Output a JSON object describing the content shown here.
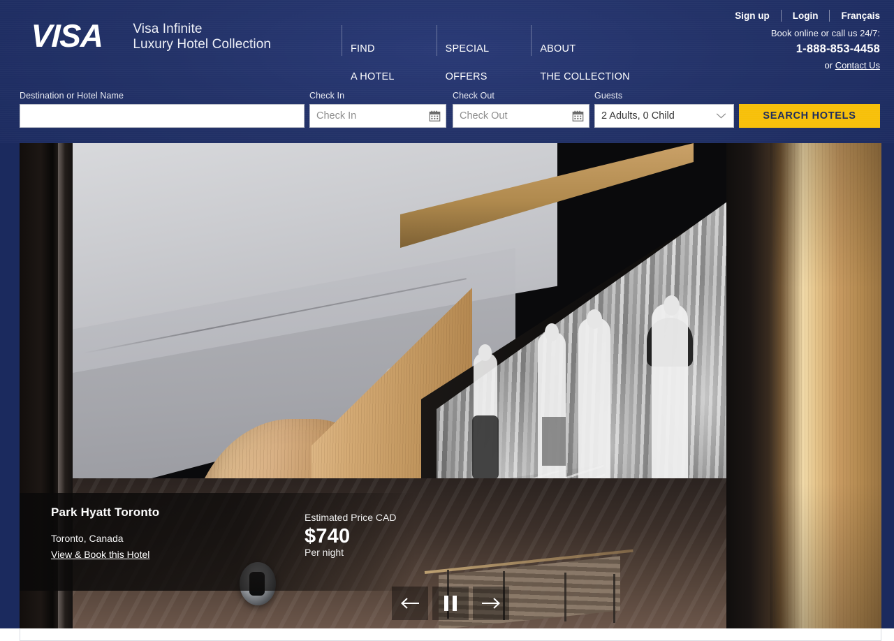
{
  "header": {
    "logo_text": "VISA",
    "brand_line1": "Visa Infinite",
    "brand_line2": "Luxury Hotel Collection",
    "nav": [
      {
        "line1": "FIND",
        "line2": "A HOTEL"
      },
      {
        "line1": "SPECIAL",
        "line2": "OFFERS"
      },
      {
        "line1": "ABOUT",
        "line2": "THE COLLECTION"
      }
    ],
    "utility": {
      "signup": "Sign up",
      "login": "Login",
      "language": "Français",
      "call_text": "Book online or call us 24/7:",
      "phone": "1-888-853-4458",
      "or_text": "or",
      "contact": "Contact Us"
    }
  },
  "search": {
    "destination": {
      "label": "Destination or Hotel Name",
      "value": "",
      "placeholder": ""
    },
    "check_in": {
      "label": "Check In",
      "value": "",
      "placeholder": "Check In",
      "icon": "calendar-icon"
    },
    "check_out": {
      "label": "Check Out",
      "value": "",
      "placeholder": "Check Out",
      "icon": "calendar-icon"
    },
    "guests": {
      "label": "Guests",
      "selected": "2 Adults, 0 Child",
      "icon": "chevron-down-icon"
    },
    "submit_label": "SEARCH HOTELS"
  },
  "hero": {
    "hotel_name": "Park Hyatt Toronto",
    "location": "Toronto,  Canada",
    "book_link": "View & Book this Hotel",
    "price_label": "Estimated Price CAD",
    "price": "$740",
    "price_unit": "Per night",
    "controls": {
      "prev": "previous-slide",
      "pause": "pause-slideshow",
      "next": "next-slide"
    }
  },
  "colors": {
    "header_navy": "#1b2a5e",
    "accent_yellow": "#f7c00a",
    "button_text_navy": "#1b2a5e",
    "white": "#ffffff"
  }
}
